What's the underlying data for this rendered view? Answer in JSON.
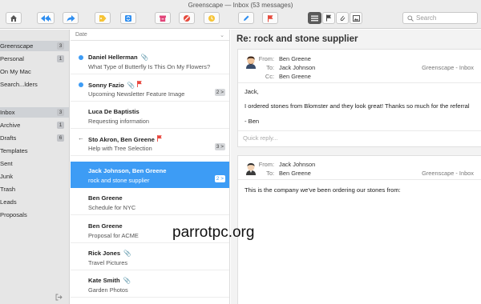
{
  "window": {
    "title": "Greenscape — Inbox (53 messages)"
  },
  "toolbar": {
    "search_placeholder": "Search",
    "buttons": [
      "home-icon",
      "reply-all-icon",
      "forward-icon",
      "tag-icon",
      "stack-icon",
      "archive-icon",
      "block-icon",
      "snooze-icon",
      "compose-icon",
      "flag-icon",
      "list-view-icon",
      "flag-filter-icon",
      "attachment-filter-icon",
      "image-filter-icon",
      "search-icon"
    ]
  },
  "sidebar": {
    "accounts": [
      {
        "label": "Greenscape",
        "count": "3"
      },
      {
        "label": "Personal",
        "count": "1"
      },
      {
        "label": "On My Mac",
        "count": ""
      },
      {
        "label": "Search...lders",
        "count": ""
      }
    ],
    "folders": [
      {
        "label": "Inbox",
        "count": "3"
      },
      {
        "label": "Archive",
        "count": "1"
      },
      {
        "label": "Drafts",
        "count": "6"
      },
      {
        "label": "Templates",
        "count": ""
      },
      {
        "label": "Sent",
        "count": ""
      },
      {
        "label": "Junk",
        "count": ""
      },
      {
        "label": "Trash",
        "count": ""
      },
      {
        "label": "Leads",
        "count": ""
      },
      {
        "label": "Proposals",
        "count": ""
      }
    ]
  },
  "list": {
    "sort_label": "Date",
    "messages": [
      {
        "sender": "Daniel Hellerman",
        "subject": "What Type of Butterfly Is This On My Flowers?",
        "unread": true,
        "attachment": true,
        "flag": false,
        "thread": "",
        "replied": false
      },
      {
        "sender": "Sonny Fazio",
        "subject": "Upcoming Newsletter Feature Image",
        "unread": true,
        "attachment": true,
        "flag": true,
        "thread": "2 >",
        "replied": false
      },
      {
        "sender": "Luca De Baptistis",
        "subject": "Requesting information",
        "unread": false,
        "attachment": false,
        "flag": false,
        "thread": "",
        "replied": false
      },
      {
        "sender": "Sto Akron, Ben Greene",
        "subject": "Help with Tree Selection",
        "unread": false,
        "attachment": false,
        "flag": true,
        "thread": "3 >",
        "replied": true
      },
      {
        "sender": "Jack Johnson, Ben Greene",
        "subject": "rock and stone supplier",
        "unread": false,
        "attachment": false,
        "flag": false,
        "thread": "2 >",
        "replied": false,
        "selected": true
      },
      {
        "sender": "Ben Greene",
        "subject": "Schedule for NYC",
        "unread": false,
        "attachment": false,
        "flag": false,
        "thread": "",
        "replied": false
      },
      {
        "sender": "Ben Greene",
        "subject": "Proposal for ACME",
        "unread": false,
        "attachment": false,
        "flag": false,
        "thread": "",
        "replied": false
      },
      {
        "sender": "Rick Jones",
        "subject": "Travel Pictures",
        "unread": false,
        "attachment": true,
        "flag": false,
        "thread": "",
        "replied": false
      },
      {
        "sender": "Kate Smith",
        "subject": "Garden Photos",
        "unread": false,
        "attachment": true,
        "flag": false,
        "thread": "",
        "replied": false
      }
    ]
  },
  "reader": {
    "subject": "Re: rock and stone supplier",
    "message1": {
      "from_label": "From:",
      "from": "Ben Greene",
      "to_label": "To:",
      "to": "Jack Johnson",
      "cc_label": "Cc:",
      "cc": "Ben Greene",
      "account": "Greenscape - Inbox",
      "body": [
        "Jack,",
        "I ordered stones from Blomster and they look great!  Thanks so much for the referral",
        "- Ben"
      ],
      "quick_reply": "Quick reply..."
    },
    "message2": {
      "from_label": "From:",
      "from": "Jack Johnson",
      "to_label": "To:",
      "to": "Ben Greene",
      "account": "Greenscape - Inbox",
      "body": [
        "This is the company we've been ordering our stones from:"
      ]
    }
  },
  "watermark": "parrotpc.org",
  "colors": {
    "accent": "#3d9cf5",
    "flag": "#e8453c",
    "toolbar_yellow": "#f6c437",
    "toolbar_pink": "#e2457a",
    "toolbar_red": "#e64a3c",
    "toolbar_blue": "#2f8ef0"
  }
}
